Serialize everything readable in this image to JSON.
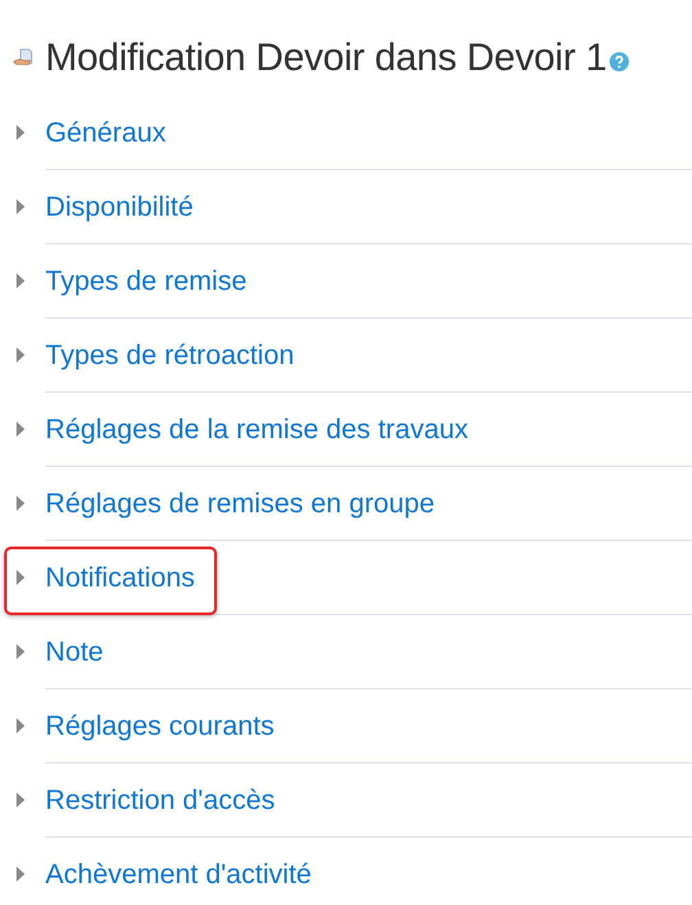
{
  "title": "Modification Devoir dans Devoir 1",
  "sections": [
    {
      "label": "Généraux",
      "expanded": false,
      "highlighted": false
    },
    {
      "label": "Disponibilité",
      "expanded": false,
      "highlighted": false
    },
    {
      "label": "Types de remise",
      "expanded": false,
      "highlighted": false
    },
    {
      "label": "Types de rétroaction",
      "expanded": false,
      "highlighted": false
    },
    {
      "label": "Réglages de la remise des travaux",
      "expanded": false,
      "highlighted": false
    },
    {
      "label": "Réglages de remises en groupe",
      "expanded": false,
      "highlighted": false
    },
    {
      "label": "Notifications",
      "expanded": false,
      "highlighted": true
    },
    {
      "label": "Note",
      "expanded": false,
      "highlighted": false
    },
    {
      "label": "Réglages courants",
      "expanded": false,
      "highlighted": false
    },
    {
      "label": "Restriction d'accès",
      "expanded": false,
      "highlighted": false
    },
    {
      "label": "Achèvement d'activité",
      "expanded": false,
      "highlighted": false
    }
  ]
}
